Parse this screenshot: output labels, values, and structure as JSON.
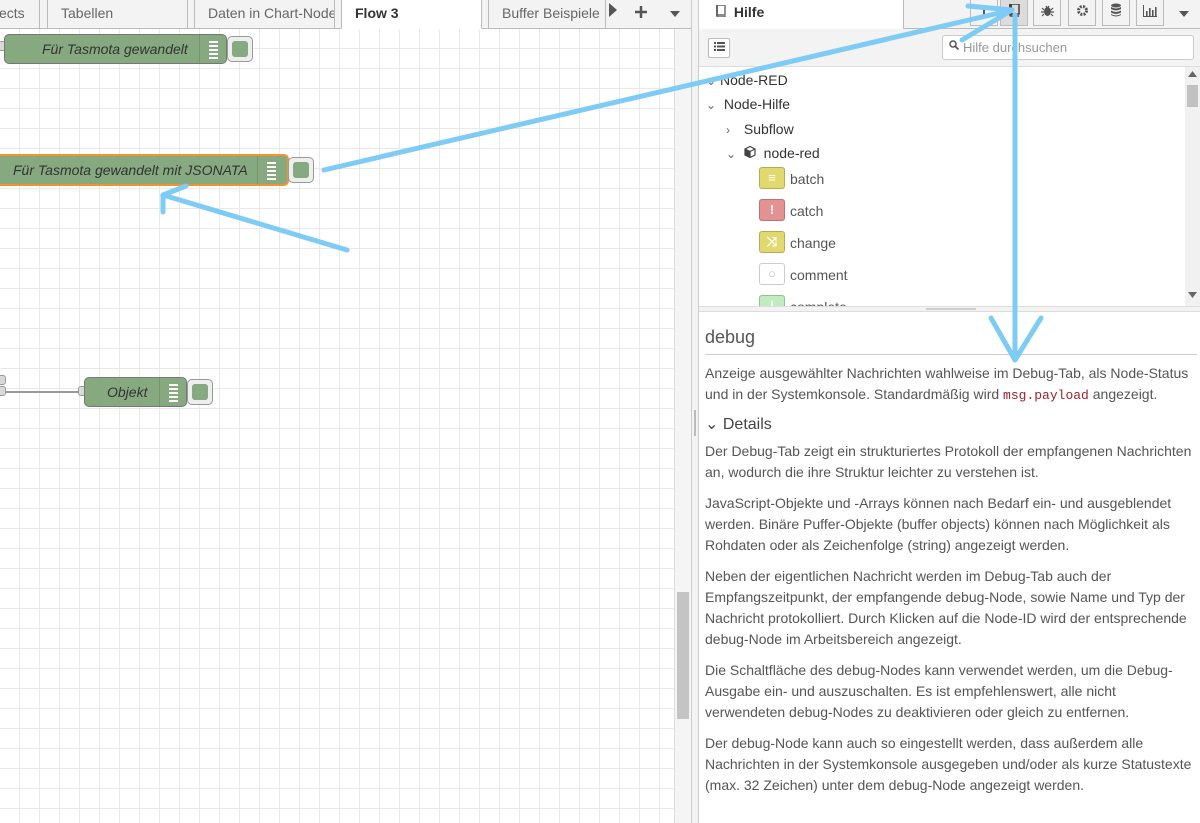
{
  "workspace": {
    "tabs": [
      {
        "label": "ects",
        "active": false
      },
      {
        "label": "Tabellen",
        "active": false
      },
      {
        "label": "Daten in Chart-Node",
        "active": false
      },
      {
        "label": "Flow 3",
        "active": true
      },
      {
        "label": "Buffer Beispiele",
        "active": false
      }
    ],
    "tab_icons": [
      "scroll-right-icon",
      "add-icon",
      "menu-caret-icon"
    ],
    "nodes": [
      {
        "label": "Für Tasmota gewandelt",
        "color": "#87a980"
      },
      {
        "label": "Für Tasmota gewandelt mit JSONATA",
        "color": "#87a980",
        "selected": true
      },
      {
        "label": "Objekt",
        "color": "#87a980"
      }
    ]
  },
  "sidebar": {
    "active_tab": {
      "icon": "book-icon",
      "label": "Hilfe"
    },
    "tab_icons": [
      "info-icon",
      "book-icon",
      "bug-icon",
      "gear-icon",
      "database-icon",
      "chart-icon",
      "caret-down-icon"
    ],
    "search": {
      "placeholder": "Hilfe durchsuchen",
      "value": ""
    },
    "tree": {
      "root": "Node-RED",
      "group": "Node-Hilfe",
      "subflow": "Subflow",
      "module": "node-red",
      "nodes": [
        {
          "label": "batch",
          "color": "#e2d96e"
        },
        {
          "label": "catch",
          "color": "#e49191"
        },
        {
          "label": "change",
          "color": "#e2d96e"
        },
        {
          "label": "comment",
          "color": "#ffffff"
        },
        {
          "label": "complete",
          "color": "#c0edc0"
        }
      ]
    },
    "help": {
      "title": "debug",
      "summary_before": "Anzeige ausgewählter Nachrichten wahlweise im Debug-Tab, als Node-Status und in der Systemkonsole. Standardmäßig wird ",
      "summary_code": "msg.payload",
      "summary_after": " angezeigt.",
      "details_heading": "Details",
      "paragraphs": [
        "Der Debug-Tab zeigt ein strukturiertes Protokoll der empfangenen Nachrichten an, wodurch die ihre Struktur leichter zu verstehen ist.",
        "JavaScript-Objekte und -Arrays können nach Bedarf ein- und ausgeblendet werden. Binäre Puffer-Objekte (buffer objects) können nach Möglichkeit als Rohdaten oder als Zeichenfolge (string) angezeigt werden.",
        "Neben der eigentlichen Nachricht werden im Debug-Tab auch der Empfangszeitpunkt, der empfangende debug-Node, sowie Name und Typ der Nachricht protokolliert. Durch Klicken auf die Node-ID wird der entsprechende debug-Node im Arbeitsbereich angezeigt.",
        "Die Schaltfläche des debug-Nodes kann verwendet werden, um die Debug-Ausgabe ein- und auszuschalten. Es ist empfehlenswert, alle nicht verwendeten debug-Nodes zu deaktivieren oder gleich zu entfernen.",
        "Der debug-Node kann auch so eingestellt werden, dass außerdem alle Nachrichten in der Systemkonsole ausgegeben und/oder als kurze Statustexte (max. 32 Zeichen) unter dem debug-Node angezeigt werden."
      ]
    }
  },
  "annotation_color": "#7ecbf5"
}
